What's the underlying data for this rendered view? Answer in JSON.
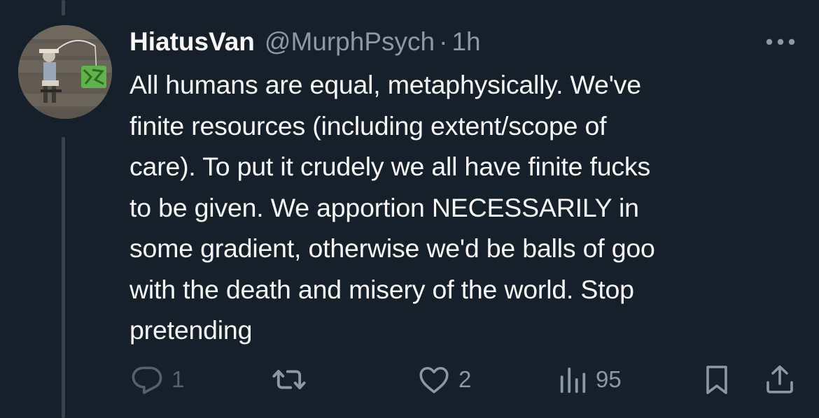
{
  "author": {
    "display_name": "HiatusVan",
    "handle": "@MurphPsych",
    "separator": "·",
    "time": "1h"
  },
  "tweet": {
    "lines": [
      "All humans are equal, metaphysically. We've",
      "finite resources (including extent/scope of",
      "care). To put it crudely we all have finite fucks",
      "to be given. We apportion NECESSARILY in",
      "some gradient, otherwise we'd be balls of goo",
      "with the death and misery of the world. Stop",
      "pretending"
    ]
  },
  "actions": {
    "reply_count": "1",
    "retweet_count": "",
    "like_count": "2",
    "views_count": "95"
  },
  "icons": {
    "more": "more-horizontal-icon",
    "reply": "reply-icon",
    "retweet": "retweet-icon",
    "like": "heart-icon",
    "views": "views-icon",
    "bookmark": "bookmark-icon",
    "share": "share-icon"
  },
  "colors": {
    "background": "#15202b",
    "primary_text": "#f7f9f9",
    "secondary_text": "#8b98a5",
    "thread_line": "#38444d"
  }
}
